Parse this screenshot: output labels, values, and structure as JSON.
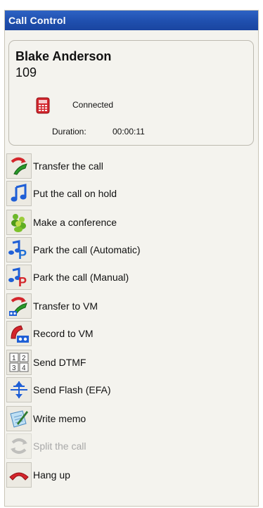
{
  "window": {
    "title": "Call Control"
  },
  "caller": {
    "name": "Blake Anderson",
    "extension": "109",
    "status": "Connected",
    "duration_label": "Duration:",
    "duration_value": "00:00:11"
  },
  "actions": [
    {
      "label": "Transfer the call",
      "icon": "transfer-icon",
      "enabled": true
    },
    {
      "label": "Put the call on hold",
      "icon": "hold-music-icon",
      "enabled": true
    },
    {
      "label": "Make a conference",
      "icon": "conference-icon",
      "enabled": true
    },
    {
      "label": "Park the call (Automatic)",
      "icon": "park-auto-icon",
      "enabled": true
    },
    {
      "label": "Park the call (Manual)",
      "icon": "park-manual-icon",
      "enabled": true
    },
    {
      "label": "Transfer to VM",
      "icon": "transfer-vm-icon",
      "enabled": true
    },
    {
      "label": "Record to VM",
      "icon": "record-vm-icon",
      "enabled": true
    },
    {
      "label": "Send DTMF",
      "icon": "dtmf-keypad-icon",
      "enabled": true
    },
    {
      "label": "Send Flash (EFA)",
      "icon": "flash-icon",
      "enabled": true
    },
    {
      "label": "Write memo",
      "icon": "memo-icon",
      "enabled": true
    },
    {
      "label": "Split the call",
      "icon": "split-icon",
      "enabled": false
    },
    {
      "label": "Hang up",
      "icon": "hangup-icon",
      "enabled": true
    }
  ],
  "colors": {
    "titlebar": "#1f4fae",
    "panel_bg": "#f4f3ee",
    "disabled_text": "#a8a8a8"
  }
}
